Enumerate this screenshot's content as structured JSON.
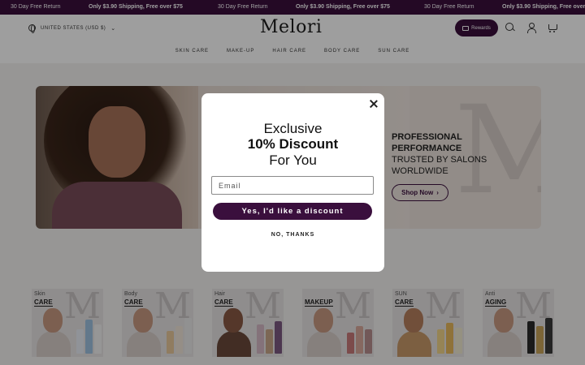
{
  "announcement": {
    "free_return": "30 Day Free Return",
    "shipping": "Only $3.90 Shipping, Free over $75"
  },
  "header": {
    "locale": "UNITED STATES (USD $)",
    "logo": "Melori",
    "rewards_label": "Rewards",
    "icons": [
      "search-icon",
      "account-icon",
      "cart-icon"
    ]
  },
  "nav": {
    "items": [
      "SKIN CARE",
      "MAKE-UP",
      "HAIR CARE",
      "BODY CARE",
      "SUN CARE"
    ]
  },
  "hero": {
    "line1": "PROFESSIONAL",
    "line2": "PERFORMANCE",
    "line3": "TRUSTED BY SALONS",
    "line4": "WORLDWIDE",
    "cta": "Shop Now"
  },
  "categories": [
    {
      "word1": "Skin",
      "word2": "CARE"
    },
    {
      "word1": "Body",
      "word2": "CARE"
    },
    {
      "word1": "Hair",
      "word2": "CARE"
    },
    {
      "word1": "",
      "word2": "MAKEUP"
    },
    {
      "word1": "SUN",
      "word2": "CARE"
    },
    {
      "word1": "Anti",
      "word2": "AGING"
    }
  ],
  "modal": {
    "line1": "Exclusive",
    "line2": "10% Discount",
    "line3": "For You",
    "email_placeholder": "Email",
    "email_value": "",
    "accept_label": "Yes, I'd like a discount",
    "decline_label": "NO, THANKS"
  },
  "colors": {
    "brand": "#3a0f3d",
    "background": "#f4f2f1"
  }
}
